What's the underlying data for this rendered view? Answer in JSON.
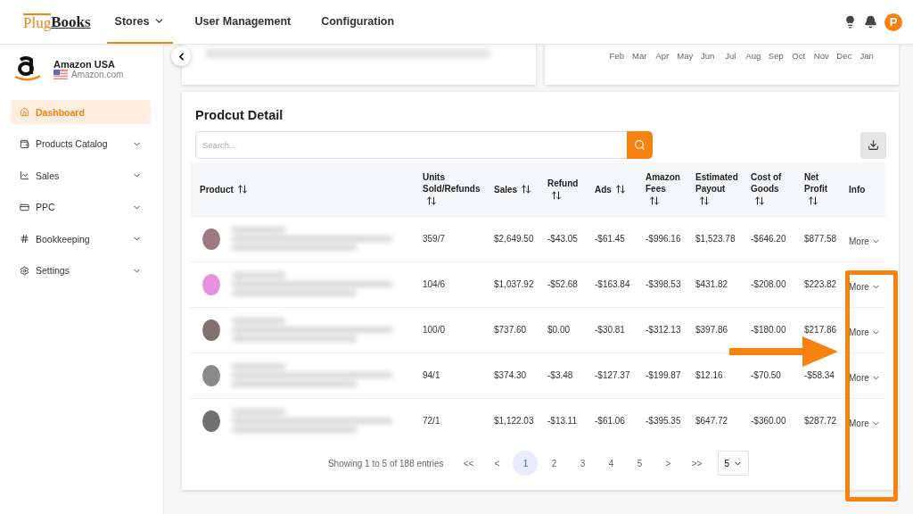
{
  "header": {
    "logo_left": "Plug",
    "logo_right": "Books",
    "nav": [
      {
        "label": "Stores",
        "selected": true,
        "dropdown": true
      },
      {
        "label": "User Management",
        "selected": false,
        "dropdown": false
      },
      {
        "label": "Configuration",
        "selected": false,
        "dropdown": false
      }
    ],
    "avatar": "P"
  },
  "store": {
    "name": "Amazon USA",
    "site": "Amazon.com"
  },
  "sidebar": {
    "items": [
      {
        "label": "Dashboard",
        "selected": true,
        "expandable": false
      },
      {
        "label": "Products Catalog",
        "selected": false,
        "expandable": true
      },
      {
        "label": "Sales",
        "selected": false,
        "expandable": true
      },
      {
        "label": "PPC",
        "selected": false,
        "expandable": true
      },
      {
        "label": "Bookkeeping",
        "selected": false,
        "expandable": true
      },
      {
        "label": "Settings",
        "selected": false,
        "expandable": true
      }
    ]
  },
  "month_labels": [
    "Feb",
    "Mar",
    "Apr",
    "May",
    "Jun",
    "Jul",
    "Aug",
    "Sep",
    "Oct",
    "Nov",
    "Dec",
    "Jan"
  ],
  "product_detail": {
    "title": "Prodcut Detail",
    "search": {
      "placeholder": "Search..."
    },
    "columns": [
      {
        "label": "Product",
        "sortable": true
      },
      {
        "label": "Units Sold/Refunds",
        "sortable": true
      },
      {
        "label": "Sales",
        "sortable": true
      },
      {
        "label": "Refund",
        "sortable": true
      },
      {
        "label": "Ads",
        "sortable": true
      },
      {
        "label": "Amazon Fees",
        "sortable": true
      },
      {
        "label": "Estimated Payout",
        "sortable": true
      },
      {
        "label": "Cost of Goods",
        "sortable": true
      },
      {
        "label": "Net Profit",
        "sortable": true
      },
      {
        "label": "Info",
        "sortable": false
      }
    ],
    "rows": [
      {
        "color": "#a07880",
        "cells": [
          "",
          "359/7",
          "$2,649.50",
          "-$43.05",
          "-$61.45",
          "-$996.16",
          "$1,523.78",
          "-$646.20",
          "$877.58",
          "More"
        ]
      },
      {
        "color": "#e890e0",
        "cells": [
          "",
          "104/6",
          "$1,037.92",
          "-$52.68",
          "-$163.84",
          "-$398.53",
          "$431.82",
          "-$208.00",
          "$223.82",
          "More"
        ]
      },
      {
        "color": "#807070",
        "cells": [
          "",
          "100/0",
          "$737.60",
          "$0.00",
          "-$30.81",
          "-$312.13",
          "$397.86",
          "-$180.00",
          "$217.86",
          "More"
        ]
      },
      {
        "color": "#8a8a8a",
        "cells": [
          "",
          "94/1",
          "$374.30",
          "-$3.48",
          "-$127.37",
          "-$199.87",
          "$12.16",
          "-$70.50",
          "-$58.34",
          "More"
        ]
      },
      {
        "color": "#707070",
        "cells": [
          "",
          "72/1",
          "$1,122.03",
          "-$13.11",
          "-$61.06",
          "-$395.35",
          "$647.72",
          "-$360.00",
          "$287.72",
          "More"
        ]
      }
    ],
    "pagination": {
      "summary": "Showing 1 to 5 of 188 entries",
      "first": "<<",
      "prev": "<",
      "pages": [
        {
          "label": "1",
          "selected": true
        },
        {
          "label": "2",
          "selected": false
        },
        {
          "label": "3",
          "selected": false
        },
        {
          "label": "4",
          "selected": false
        },
        {
          "label": "5",
          "selected": false
        }
      ],
      "next": ">",
      "last": ">>",
      "page_size": "5"
    }
  }
}
